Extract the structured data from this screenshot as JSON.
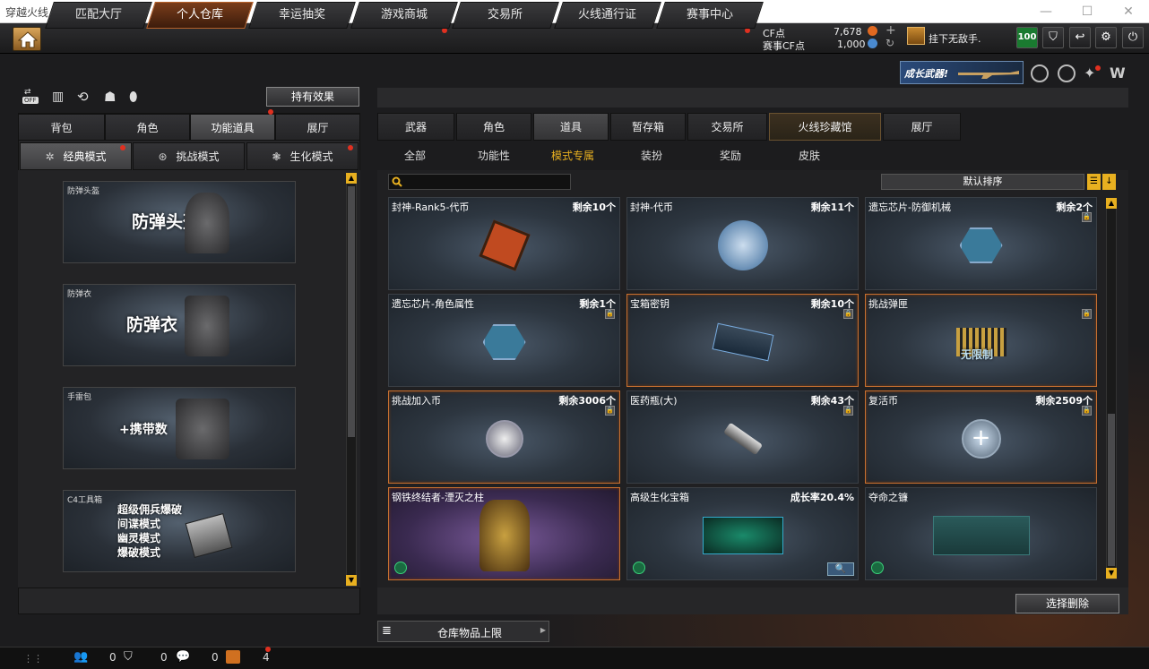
{
  "window": {
    "title": "穿越火线",
    "controls": [
      "—",
      "☐",
      "✕"
    ]
  },
  "nav": {
    "tabs": [
      "匹配大厅",
      "个人仓库",
      "幸运抽奖",
      "游戏商城",
      "交易所",
      "火线通行证",
      "赛事中心"
    ],
    "active": 1
  },
  "currency": {
    "cf_label": "CF点",
    "cf_value": "7,678",
    "event_label": "赛事CF点",
    "event_value": "1,000"
  },
  "user": {
    "name": "挂下无敌手.",
    "level_badge": "100"
  },
  "banner": {
    "text": "成长武器!"
  },
  "left": {
    "effect_button": "持有效果",
    "off_label": "OFF",
    "tabs": [
      "背包",
      "角色",
      "功能道具",
      "展厅"
    ],
    "active_tab": 2,
    "modes": [
      "经典模式",
      "挑战模式",
      "生化模式"
    ],
    "active_mode": 0,
    "cards": [
      {
        "label": "防弹头盔",
        "big": "防弹头盔"
      },
      {
        "label": "防弹衣",
        "big": "防弹衣"
      },
      {
        "label": "手雷包",
        "big": "+携带数"
      },
      {
        "label": "C4工具箱",
        "lines": [
          "超级佣兵爆破",
          "间谍模式",
          "幽灵模式",
          "爆破模式"
        ]
      }
    ]
  },
  "right": {
    "tabs": [
      "武器",
      "角色",
      "道具",
      "暂存箱",
      "交易所",
      "火线珍藏馆",
      "展厅"
    ],
    "active_tab": 2,
    "subtabs": [
      "全部",
      "功能性",
      "模式专属",
      "装扮",
      "奖励",
      "皮肤"
    ],
    "active_sub": 2,
    "search_placeholder": "",
    "sort_label": "默认排序",
    "items": [
      {
        "name": "封神-Rank5-代币",
        "count": "剩余10个",
        "lock": false,
        "hl": false
      },
      {
        "name": "封神-代币",
        "count": "剩余11个",
        "lock": false,
        "hl": false
      },
      {
        "name": "遗忘芯片-防御机械",
        "count": "剩余2个",
        "lock": true,
        "hl": false
      },
      {
        "name": "遗忘芯片-角色属性",
        "count": "剩余1个",
        "lock": true,
        "hl": false
      },
      {
        "name": "宝箱密钥",
        "count": "剩余10个",
        "lock": true,
        "hl": true
      },
      {
        "name": "挑战弹匣",
        "count": "",
        "lock": true,
        "hl": true,
        "overlay": "无限制"
      },
      {
        "name": "挑战加入币",
        "count": "剩余3006个",
        "lock": true,
        "hl": true
      },
      {
        "name": "医药瓶(大)",
        "count": "剩余43个",
        "lock": true,
        "hl": false
      },
      {
        "name": "复活币",
        "count": "剩余2509个",
        "lock": true,
        "hl": true
      },
      {
        "name": "钢铁终结者-湮灭之柱",
        "count": "",
        "lock": false,
        "hl": true
      },
      {
        "name": "高级生化宝箱",
        "count": "成长率20.4%",
        "lock": false,
        "hl": false
      },
      {
        "name": "夺命之镰",
        "count": "",
        "lock": false,
        "hl": false
      }
    ],
    "delete_button": "选择删除",
    "capacity_label": "仓库物品上限"
  },
  "bottom": {
    "counts": [
      "0",
      "0",
      "0",
      "4"
    ]
  }
}
